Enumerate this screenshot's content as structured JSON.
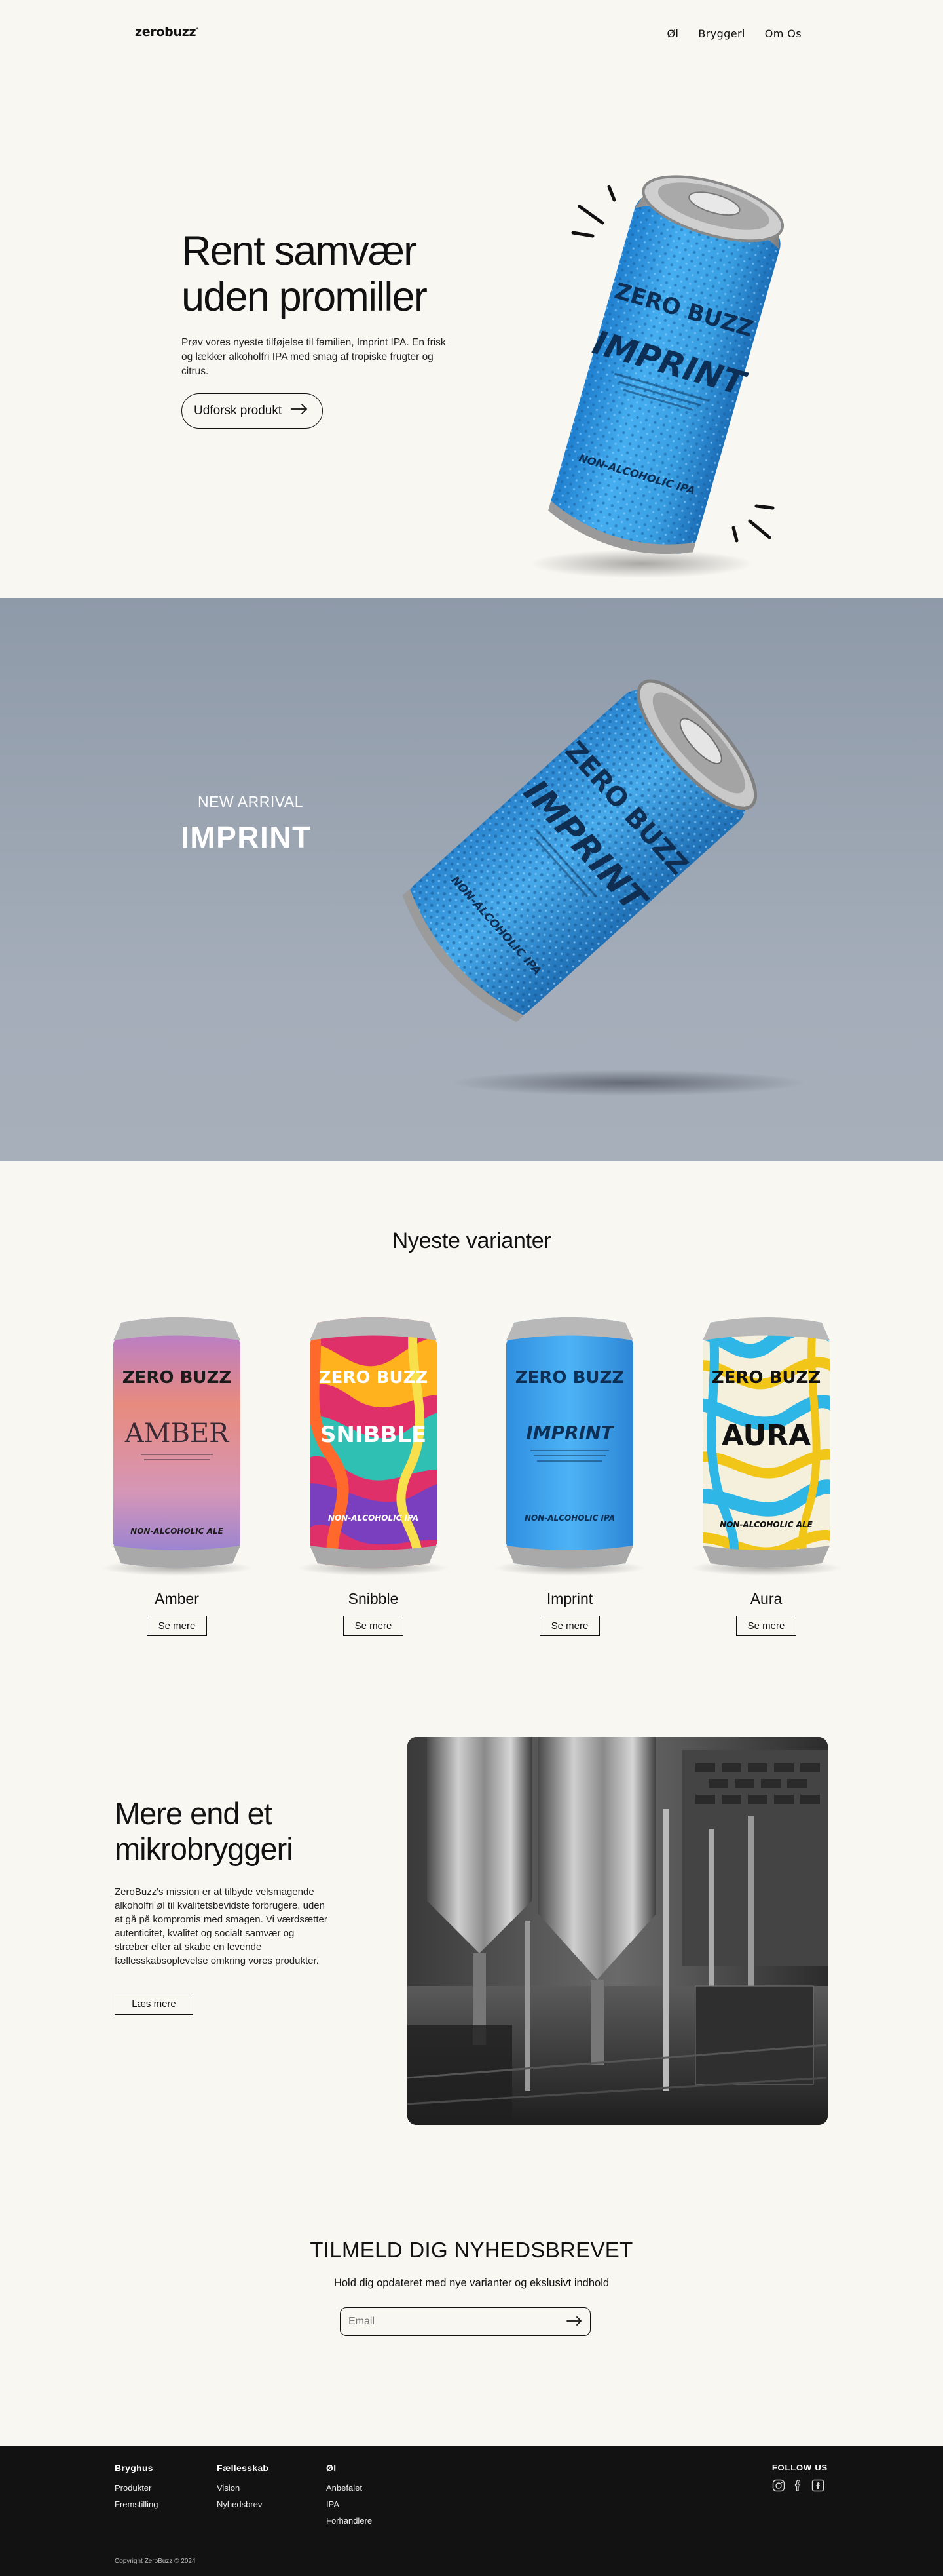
{
  "header": {
    "logo": "zerobuzz",
    "logo_mark": "°",
    "nav": [
      {
        "label": "Øl"
      },
      {
        "label": "Bryggeri"
      },
      {
        "label": "Om Os"
      }
    ]
  },
  "hero": {
    "title_line1": "Rent samvær",
    "title_line2": "uden promiller",
    "body": "Prøv vores nyeste tilføjelse til familien, Imprint IPA. En frisk og lækker alkoholfri IPA med smag af tropiske frugter og citrus.",
    "cta_label": "Udforsk produkt",
    "can": {
      "brand": "ZERO BUZZ",
      "name": "IMPRINT",
      "type": "NON-ALCOHOLIC IPA",
      "color": "#3aa3e6"
    }
  },
  "arrival": {
    "kicker": "NEW ARRIVAL",
    "title": "IMPRINT",
    "can": {
      "brand": "ZERO BUZZ",
      "name": "IMPRINT",
      "type": "NON-ALCOHOLIC IPA"
    }
  },
  "variants": {
    "heading": "Nyeste varianter",
    "button_label": "Se mere",
    "items": [
      {
        "name": "Amber",
        "can_name": "AMBER",
        "type": "NON-ALCOHOLIC ALE",
        "brand": "ZERO BUZZ",
        "style": "amber"
      },
      {
        "name": "Snibble",
        "can_name": "SNIBBLE",
        "type": "NON-ALCOHOLIC IPA",
        "brand": "ZERO BUZZ",
        "style": "snibble"
      },
      {
        "name": "Imprint",
        "can_name": "IMPRINT",
        "type": "NON-ALCOHOLIC IPA",
        "brand": "ZERO BUZZ",
        "style": "imprint"
      },
      {
        "name": "Aura",
        "can_name": "AURA",
        "type": "NON-ALCOHOLIC ALE",
        "brand": "ZERO BUZZ",
        "style": "aura"
      }
    ]
  },
  "brewery": {
    "title_line1": "Mere end et",
    "title_line2": "mikrobryggeri",
    "body": "ZeroBuzz's mission er at tilbyde velsmagende alkoholfri øl til kvalitetsbevidste forbrugere, uden at gå på kompromis med smagen. Vi værdsætter autenticitet, kvalitet og socialt samvær og stræber efter at skabe en levende fællesskabsoplevelse omkring vores produkter.",
    "button_label": "Læs mere"
  },
  "newsletter": {
    "title": "TILMELD DIG NYHEDSBREVET",
    "subtitle": "Hold dig opdateret med nye varianter og ekslusivt indhold",
    "placeholder": "Email"
  },
  "footer": {
    "columns": [
      {
        "heading": "Bryghus",
        "links": [
          "Produkter",
          "Fremstilling"
        ]
      },
      {
        "heading": "Fællesskab",
        "links": [
          "Vision",
          "Nyhedsbrev"
        ]
      },
      {
        "heading": "Øl",
        "links": [
          "Anbefalet",
          "IPA",
          "Forhandlere"
        ]
      }
    ],
    "follow_label": "FOLLOW US",
    "social": [
      "instagram-icon",
      "facebook-icon",
      "untappd-icon"
    ],
    "copyright": "Copyright ZeroBuzz © 2024"
  },
  "colors": {
    "background": "#f8f7f2",
    "arrival_bg": "#98a3b1",
    "footer_bg": "#121212",
    "imprint_blue": "#3aa3e6"
  }
}
